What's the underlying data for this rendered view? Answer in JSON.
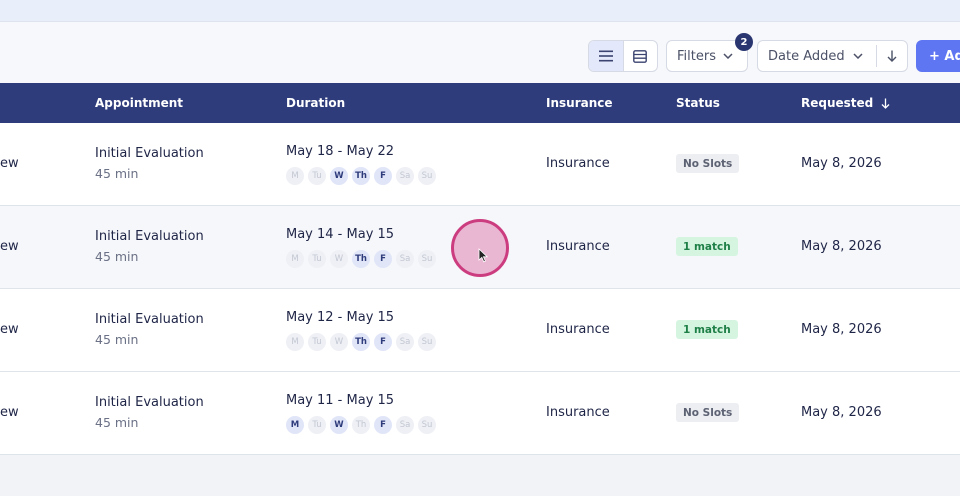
{
  "toolbar": {
    "view_modes": [
      {
        "name": "list-view",
        "icon": "list-icon",
        "active": true
      },
      {
        "name": "table-view",
        "icon": "table-icon",
        "active": false
      }
    ],
    "filters_label": "Filters",
    "filters_count": "2",
    "sort_label": "Date Added",
    "sort_direction_icon": "arrow-down-icon",
    "add_label": "+ Ad"
  },
  "table": {
    "columns": {
      "appointment": "Appointment",
      "duration": "Duration",
      "insurance": "Insurance",
      "status": "Status",
      "requested": "Requested"
    },
    "rows": [
      {
        "view": "ew",
        "appointment": "Initial Evaluation",
        "length": "45 min",
        "range": "May 18 - May 22",
        "days": [
          "M",
          "Tu",
          "W",
          "Th",
          "F",
          "Sa",
          "Su"
        ],
        "active_days": [
          false,
          false,
          true,
          true,
          true,
          false,
          false
        ],
        "insurance": "Insurance",
        "status": "No Slots",
        "status_kind": "none",
        "requested": "May 8, 2026"
      },
      {
        "view": "ew",
        "appointment": "Initial Evaluation",
        "length": "45 min",
        "range": "May 14 - May 15",
        "days": [
          "M",
          "Tu",
          "W",
          "Th",
          "F",
          "Sa",
          "Su"
        ],
        "active_days": [
          false,
          false,
          false,
          true,
          true,
          false,
          false
        ],
        "insurance": "Insurance",
        "status": "1 match",
        "status_kind": "match",
        "requested": "May 8, 2026"
      },
      {
        "view": "ew",
        "appointment": "Initial Evaluation",
        "length": "45 min",
        "range": "May 12 - May 15",
        "days": [
          "M",
          "Tu",
          "W",
          "Th",
          "F",
          "Sa",
          "Su"
        ],
        "active_days": [
          false,
          false,
          false,
          true,
          true,
          false,
          false
        ],
        "insurance": "Insurance",
        "status": "1 match",
        "status_kind": "match",
        "requested": "May 8, 2026"
      },
      {
        "view": "ew",
        "appointment": "Initial Evaluation",
        "length": "45 min",
        "range": "May 11 - May 15",
        "days": [
          "M",
          "Tu",
          "W",
          "Th",
          "F",
          "Sa",
          "Su"
        ],
        "active_days": [
          true,
          false,
          true,
          false,
          true,
          false,
          false
        ],
        "insurance": "Insurance",
        "status": "No Slots",
        "status_kind": "none",
        "requested": "May 8, 2026"
      }
    ]
  },
  "colors": {
    "header_bg": "#2f3c7c",
    "accent": "#5e76f2",
    "match_bg": "#d6f5e1",
    "match_text": "#1e7f47",
    "cursor_ring": "#cc3d80"
  }
}
